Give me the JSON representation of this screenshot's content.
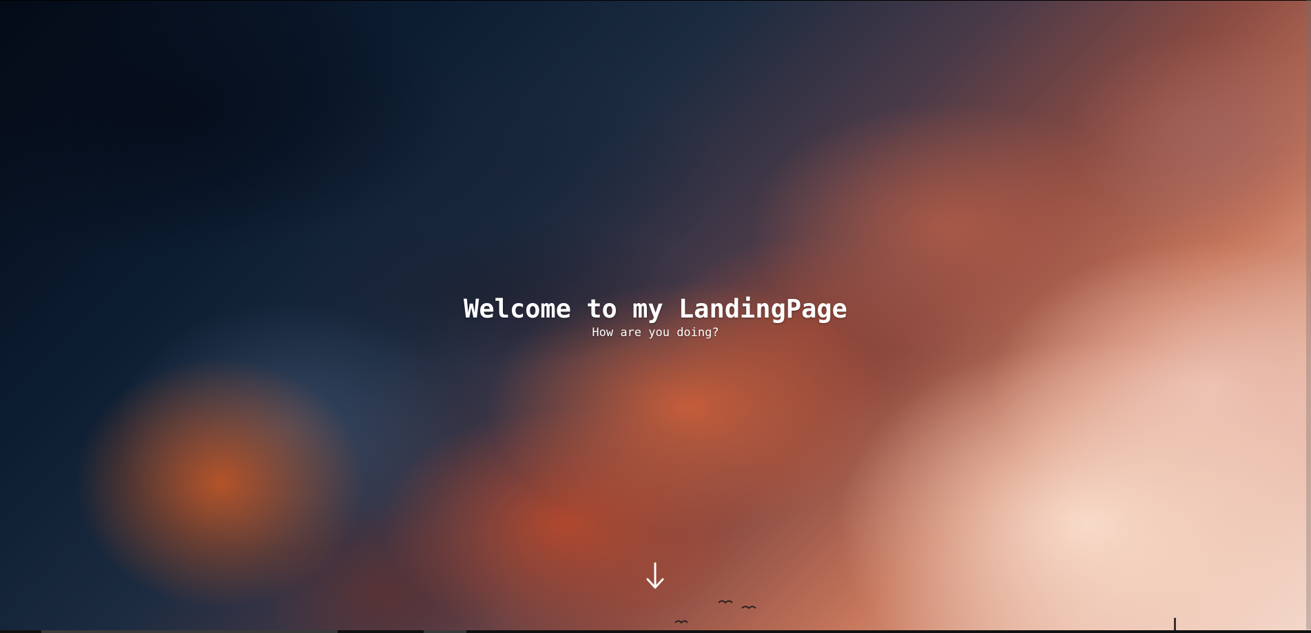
{
  "hero": {
    "title": "Welcome to my LandingPage",
    "subtitle": "How are you doing?",
    "scroll_icon": "arrow-down-icon"
  },
  "colors": {
    "text": "#ffffff",
    "sky_dark": "#0c1c30",
    "sky_light": "#f4d8cb",
    "cloud_accent": "#d6623a"
  }
}
